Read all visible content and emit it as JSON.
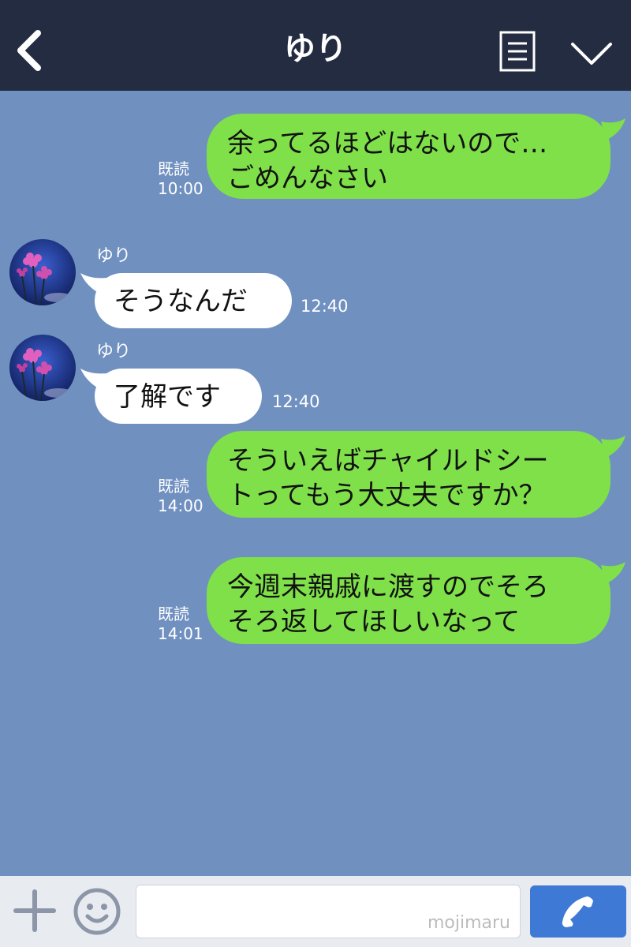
{
  "header": {
    "title": "ゆり",
    "back_icon": "chevron-left-icon",
    "menu_icon": "document-list-icon",
    "collapse_icon": "chevron-down-icon"
  },
  "messages": [
    {
      "side": "out",
      "lines": [
        "余ってるほどはないので…",
        "ごめんなさい"
      ],
      "read": "既読",
      "time": "10:00"
    },
    {
      "side": "in",
      "sender": "ゆり",
      "lines": [
        "そうなんだ"
      ],
      "time": "12:40"
    },
    {
      "side": "in",
      "sender": "ゆり",
      "lines": [
        "了解です"
      ],
      "time": "12:40"
    },
    {
      "side": "out",
      "lines": [
        "そういえばチャイルドシー",
        "トってもう大丈夫ですか？"
      ],
      "read": "既読",
      "time": "14:00"
    },
    {
      "side": "out",
      "lines": [
        "今週末親戚に渡すのでそろ",
        "そろ返してほしいなって"
      ],
      "read": "既読",
      "time": "14:01"
    }
  ],
  "footer": {
    "input_value": "",
    "watermark": "mojimaru",
    "plus_icon": "plus-icon",
    "emoji_icon": "smiley-icon",
    "call_icon": "phone-icon"
  },
  "colors": {
    "header_bg": "#232c40",
    "chat_bg": "#7090c0",
    "outgoing_bubble": "#7fe04a",
    "incoming_bubble": "#ffffff",
    "call_button": "#3e79d6"
  }
}
